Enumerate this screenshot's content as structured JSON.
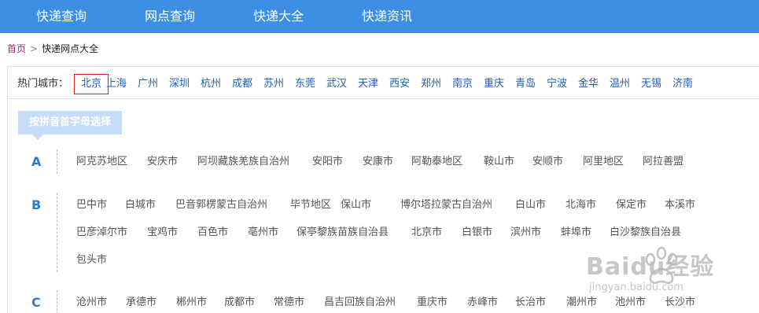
{
  "nav": {
    "items": [
      "快递查询",
      "网点查询",
      "快递大全",
      "快递资讯"
    ]
  },
  "breadcrumb": {
    "home": "首页",
    "separator": ">",
    "current": "快递网点大全"
  },
  "hot_cities": {
    "label": "热门城市：",
    "selected_index": 0,
    "items": [
      "北京",
      "上海",
      "广州",
      "深圳",
      "杭州",
      "成都",
      "苏州",
      "东莞",
      "武汉",
      "天津",
      "西安",
      "郑州",
      "南京",
      "重庆",
      "青岛",
      "宁波",
      "金华",
      "温州",
      "无锡",
      "济南"
    ]
  },
  "pinyin_tab": "按拼音首字母选择",
  "groups": [
    {
      "letter": "A",
      "rows": [
        [
          "阿克苏地区",
          "安庆市",
          "阿坝藏族羌族自治州",
          "安阳市",
          "安康市",
          "阿勒泰地区",
          "鞍山市",
          "安顺市",
          "阿里地区",
          "阿拉善盟"
        ]
      ]
    },
    {
      "letter": "B",
      "rows": [
        [
          "巴中市",
          "白城市",
          "巴音郭楞蒙古自治州",
          "毕节地区",
          "保山市",
          "博尔塔拉蒙古自治州",
          "白山市",
          "北海市",
          "保定市",
          "本溪市"
        ],
        [
          "巴彦淖尔市",
          "宝鸡市",
          "百色市",
          "亳州市",
          "保亭黎族苗族自治县",
          "北京市",
          "白银市",
          "滨州市",
          "蚌埠市",
          "白沙黎族自治县"
        ],
        [
          "包头市"
        ]
      ]
    },
    {
      "letter": "C",
      "rows": [
        [
          "沧州市",
          "承德市",
          "郴州市",
          "成都市",
          "常德市",
          "昌吉回族自治州",
          "重庆市",
          "赤峰市",
          "长治市",
          "潮州市",
          "池州市",
          "长沙市"
        ]
      ]
    }
  ],
  "watermark": {
    "brand": "Baidu经验",
    "url": "jingyan.baidu.com"
  },
  "colors": {
    "nav_bg": "#3d8fe3",
    "link": "#1f5fb8",
    "letter": "#2b7bd6",
    "selected_border": "#dd2222",
    "tab_bg": "#c6dcf8"
  }
}
